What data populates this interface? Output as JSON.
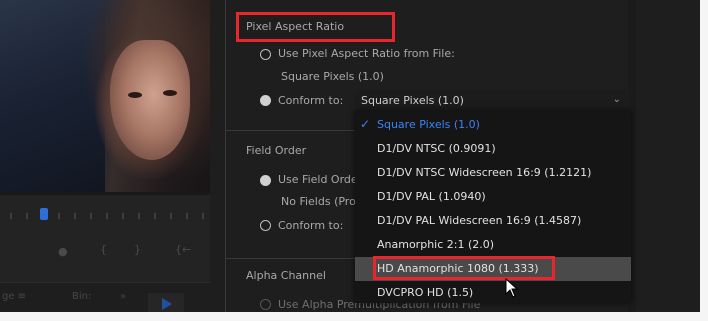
{
  "left_panel": {
    "bottom_tabs": [
      "ge ≡",
      "Bin:",
      "»"
    ]
  },
  "pixel_aspect": {
    "section_title": "Pixel Aspect Ratio",
    "use_from_file_label": "Use Pixel Aspect Ratio from File:",
    "file_value": "Square Pixels (1.0)",
    "conform_label": "Conform to:",
    "conform_selected": "Square Pixels (1.0)"
  },
  "dropdown": {
    "items": [
      "Square Pixels (1.0)",
      "D1/DV NTSC (0.9091)",
      "D1/DV NTSC Widescreen 16:9 (1.2121)",
      "D1/DV PAL (1.0940)",
      "D1/DV PAL Widescreen 16:9 (1.4587)",
      "Anamorphic 2:1 (2.0)",
      "HD Anamorphic 1080 (1.333)",
      "DVCPRO HD (1.5)"
    ],
    "selected_index": 0,
    "highlighted_index": 6
  },
  "field_order": {
    "section_title": "Field Order",
    "use_field_label": "Use Field Orde",
    "no_fields_label": "No Fields (Pro",
    "conform_label": "Conform to:"
  },
  "alpha_channel": {
    "section_title": "Alpha Channel",
    "option_label": "Use Alpha Premultiplication from File"
  },
  "colors": {
    "highlight_box": "#e8262c",
    "accent_blue": "#3b83f5"
  }
}
